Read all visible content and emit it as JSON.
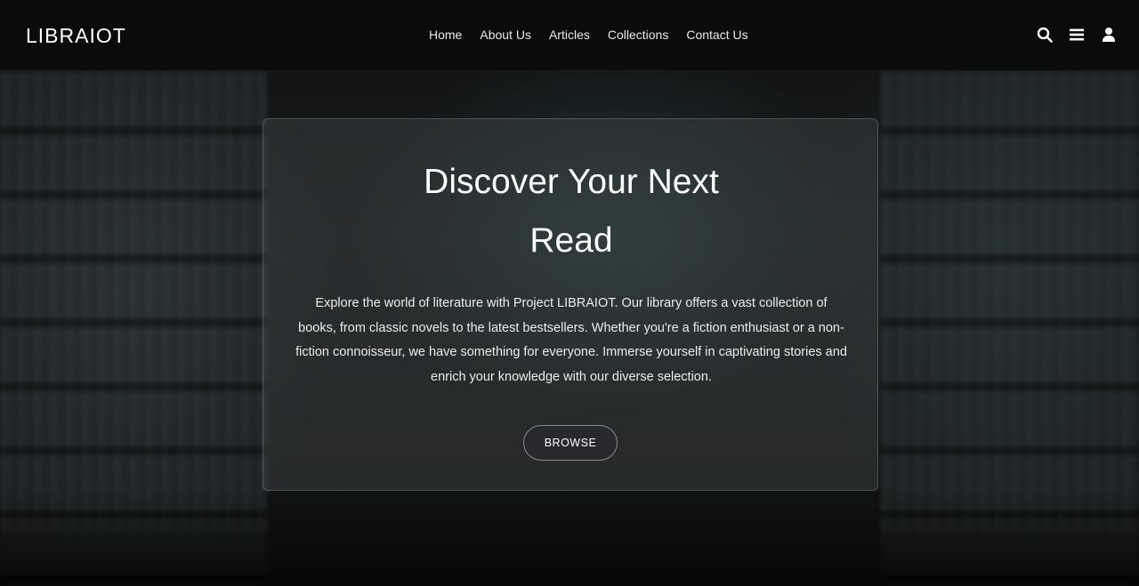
{
  "navbar": {
    "logo": "LIBRAIOT",
    "links": [
      "Home",
      "About Us",
      "Articles",
      "Collections",
      "Contact Us"
    ],
    "icons": [
      "search-icon",
      "menu-icon",
      "user-icon"
    ]
  },
  "hero": {
    "title": "Discover Your Next Read",
    "description": "Explore the world of literature with Project LIBRAIOT. Our library offers a vast collection of books, from classic novels to the latest bestsellers. Whether you're a fiction enthusiast or a non-fiction connoisseur, we have something for everyone. Immerse yourself in captivating stories and enrich your knowledge with our diverse selection.",
    "button_label": "BROWSE"
  },
  "colors": {
    "navbar_bg": "#0a0a0a",
    "text": "#ffffff",
    "card_bg": "#464a4c"
  }
}
